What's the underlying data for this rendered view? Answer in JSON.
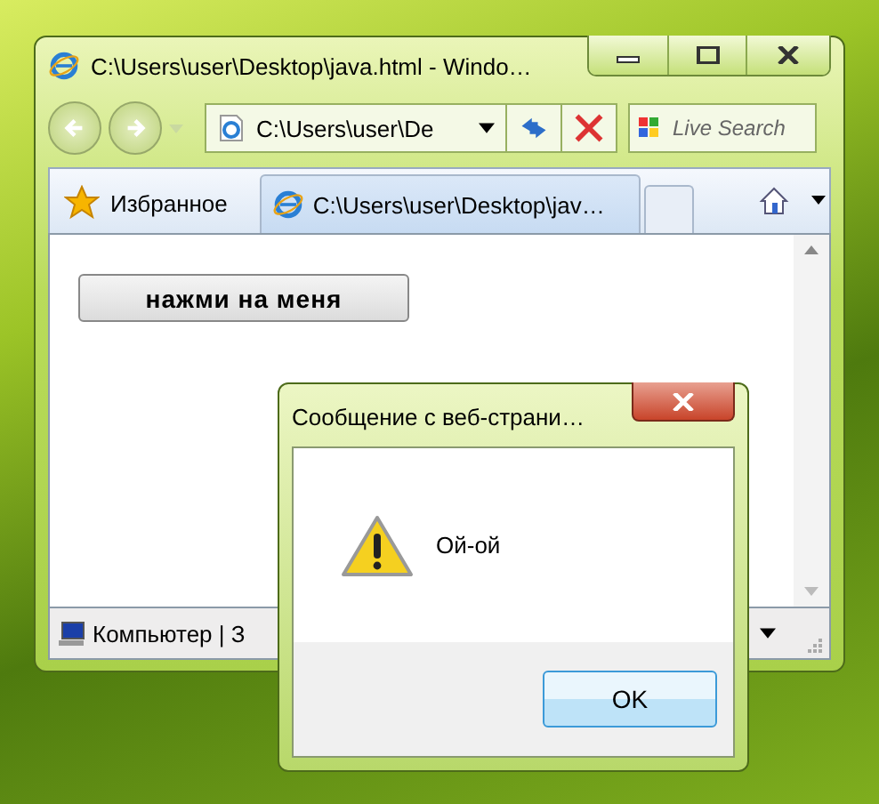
{
  "browser": {
    "title": "C:\\Users\\user\\Desktop\\java.html - Windo…",
    "address": "C:\\Users\\user\\De",
    "search": {
      "placeholder": "Live Search"
    },
    "favorites": "Избранное",
    "tabs": [
      {
        "label": "C:\\Users\\user\\Desktop\\jav…",
        "selected": true
      }
    ],
    "page_button": "нажми на меня",
    "status_bar": "Компьютер | З"
  },
  "dialog": {
    "title": "Сообщение с веб-страни…",
    "message": "Ой-ой",
    "buttons": [
      "OK"
    ]
  }
}
